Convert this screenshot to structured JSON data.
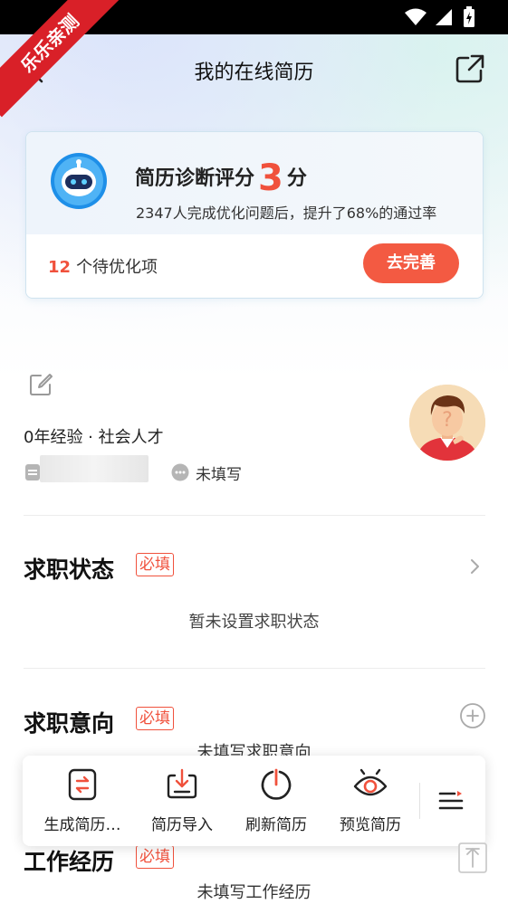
{
  "watermark": "乐乐亲测",
  "header": {
    "title": "我的在线简历"
  },
  "diagnosis": {
    "title_prefix": "简历诊断评分",
    "score": "3",
    "title_suffix": "分",
    "description": "2347人完成优化问题后，提升了68%的通过率",
    "pending_count": "12",
    "pending_label": "个待优化项",
    "improve_button": "去完善"
  },
  "profile": {
    "experience": "0年经验 · 社会人才",
    "wechat": "未填写"
  },
  "sections": {
    "job_status": {
      "title": "求职状态",
      "tag": "必填",
      "empty": "暂未设置求职状态"
    },
    "job_intention": {
      "title": "求职意向",
      "tag": "必填",
      "empty": "未填写求职意向"
    },
    "work_experience": {
      "title": "工作经历",
      "tag": "必填",
      "empty": "未填写工作经历"
    }
  },
  "toolbar": {
    "items": [
      {
        "label": "生成简历…",
        "icon": "generate-resume-icon"
      },
      {
        "label": "简历导入",
        "icon": "import-icon"
      },
      {
        "label": "刷新简历",
        "icon": "refresh-icon"
      },
      {
        "label": "预览简历",
        "icon": "eye-icon"
      }
    ],
    "more_icon": "menu-icon"
  },
  "colors": {
    "accent": "#f0513c",
    "button": "#f35a42"
  }
}
